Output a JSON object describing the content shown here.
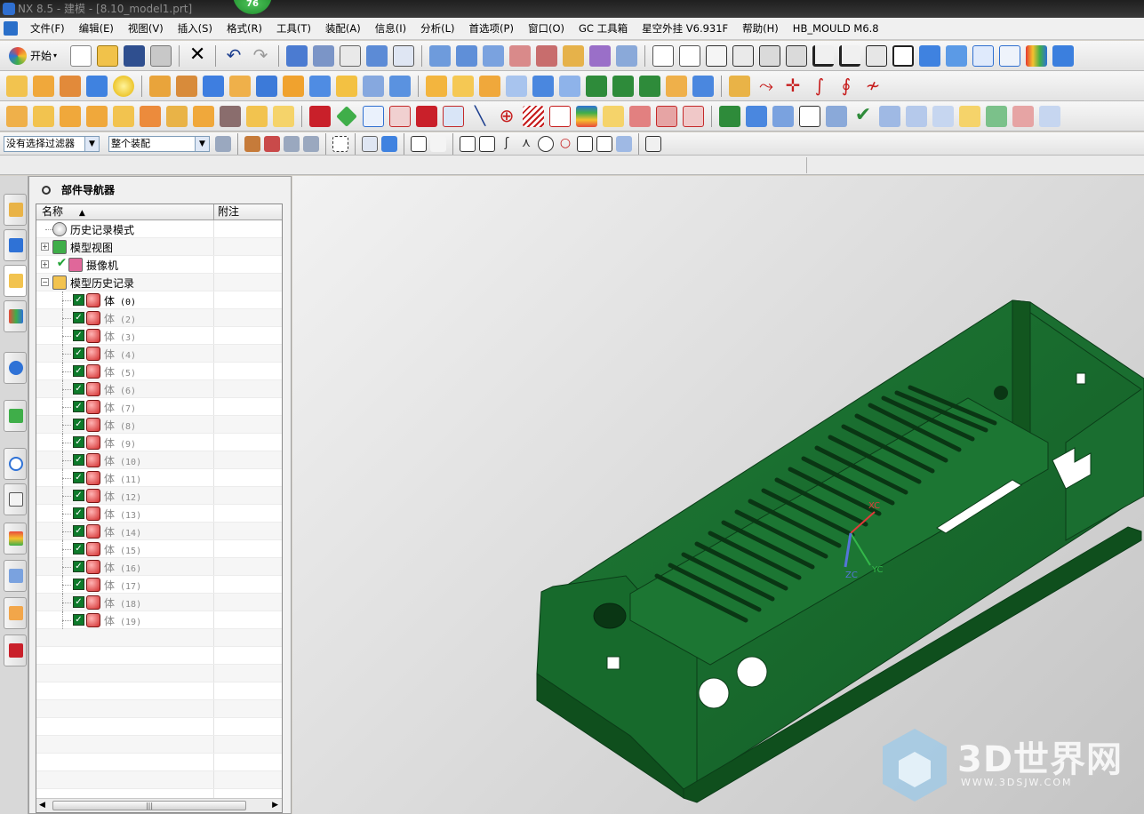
{
  "window": {
    "title": "NX 8.5 - 建模 - [8.10_model1.prt]",
    "badge": "76"
  },
  "menubar": {
    "items": [
      "文件(F)",
      "编辑(E)",
      "视图(V)",
      "插入(S)",
      "格式(R)",
      "工具(T)",
      "装配(A)",
      "信息(I)",
      "分析(L)",
      "首选项(P)",
      "窗口(O)",
      "GC 工具箱",
      "星空外挂 V6.931F",
      "帮助(H)",
      "HB_MOULD M6.8"
    ]
  },
  "toolbar": {
    "start_label": "开始"
  },
  "selection_bar": {
    "filter_value": "没有选择过滤器",
    "scope_value": "整个装配"
  },
  "navigator": {
    "title": "部件导航器",
    "col_name": "名称",
    "col_note": "附注",
    "nodes": [
      {
        "label": "历史记录模式",
        "level": 0,
        "expander": "",
        "icon": "clock-icon"
      },
      {
        "label": "模型视图",
        "level": 0,
        "expander": "+",
        "icon": "model-views-icon"
      },
      {
        "label": "摄像机",
        "level": 0,
        "expander": "+",
        "icon": "camera-icon"
      },
      {
        "label": "模型历史记录",
        "level": 0,
        "expander": "−",
        "icon": "folder-icon"
      }
    ],
    "features": [
      {
        "label": "体",
        "idx": "(0)",
        "dim": false
      },
      {
        "label": "体",
        "idx": "(2)",
        "dim": true
      },
      {
        "label": "体",
        "idx": "(3)",
        "dim": true
      },
      {
        "label": "体",
        "idx": "(4)",
        "dim": true
      },
      {
        "label": "体",
        "idx": "(5)",
        "dim": true
      },
      {
        "label": "体",
        "idx": "(6)",
        "dim": true
      },
      {
        "label": "体",
        "idx": "(7)",
        "dim": true
      },
      {
        "label": "体",
        "idx": "(8)",
        "dim": true
      },
      {
        "label": "体",
        "idx": "(9)",
        "dim": true
      },
      {
        "label": "体",
        "idx": "(10)",
        "dim": true
      },
      {
        "label": "体",
        "idx": "(11)",
        "dim": true
      },
      {
        "label": "体",
        "idx": "(12)",
        "dim": true
      },
      {
        "label": "体",
        "idx": "(13)",
        "dim": true
      },
      {
        "label": "体",
        "idx": "(14)",
        "dim": true
      },
      {
        "label": "体",
        "idx": "(15)",
        "dim": true
      },
      {
        "label": "体",
        "idx": "(16)",
        "dim": true
      },
      {
        "label": "体",
        "idx": "(17)",
        "dim": true
      },
      {
        "label": "体",
        "idx": "(18)",
        "dim": true
      },
      {
        "label": "体",
        "idx": "(19)",
        "dim": true
      }
    ]
  },
  "viewport": {
    "axes": {
      "x": "XC",
      "y": "YC",
      "z": "ZC"
    },
    "model_color": "#166b2c",
    "watermark_text": "3D世界网",
    "watermark_url": "WWW.3DSJW.COM"
  },
  "colors": {
    "accent": "#2f72d6",
    "check_green": "#0d7a2a",
    "feature_red": "#d32f2f"
  }
}
